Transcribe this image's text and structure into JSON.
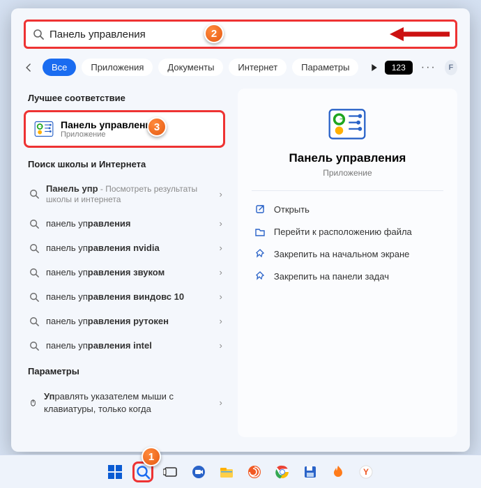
{
  "search": {
    "value": "Панель управления"
  },
  "tabs": {
    "all": "Все",
    "apps": "Приложения",
    "docs": "Документы",
    "web": "Интернет",
    "settings": "Параметры",
    "badge": "123",
    "avatar": "F"
  },
  "sections": {
    "best": "Лучшее соответствие",
    "web": "Поиск школы и Интернета",
    "settings": "Параметры"
  },
  "best": {
    "title": "Панель управления",
    "subtitle": "Приложение"
  },
  "suggestions": {
    "s1_a": "Панель упр",
    "s1_b": " - Посмотреть результаты школы и интернета",
    "s2_a": "панель уп",
    "s2_b": "равления",
    "s3_a": "панель уп",
    "s3_b": "равления nvidia",
    "s4_a": "панель уп",
    "s4_b": "равления звуком",
    "s5_a": "панель уп",
    "s5_b": "равления виндовс 10",
    "s6_a": "панель уп",
    "s6_b": "равления рутокен",
    "s7_a": "панель уп",
    "s7_b": "равления intel"
  },
  "settings_row": {
    "a": "Уп",
    "b": "равлять указателем мыши с клавиатуры, только когда"
  },
  "preview": {
    "title": "Панель управления",
    "subtitle": "Приложение",
    "open": "Открыть",
    "location": "Перейти к расположению файла",
    "pin_start": "Закрепить на начальном экране",
    "pin_task": "Закрепить на панели задач"
  },
  "annotations": {
    "b1": "1",
    "b2": "2",
    "b3": "3"
  }
}
